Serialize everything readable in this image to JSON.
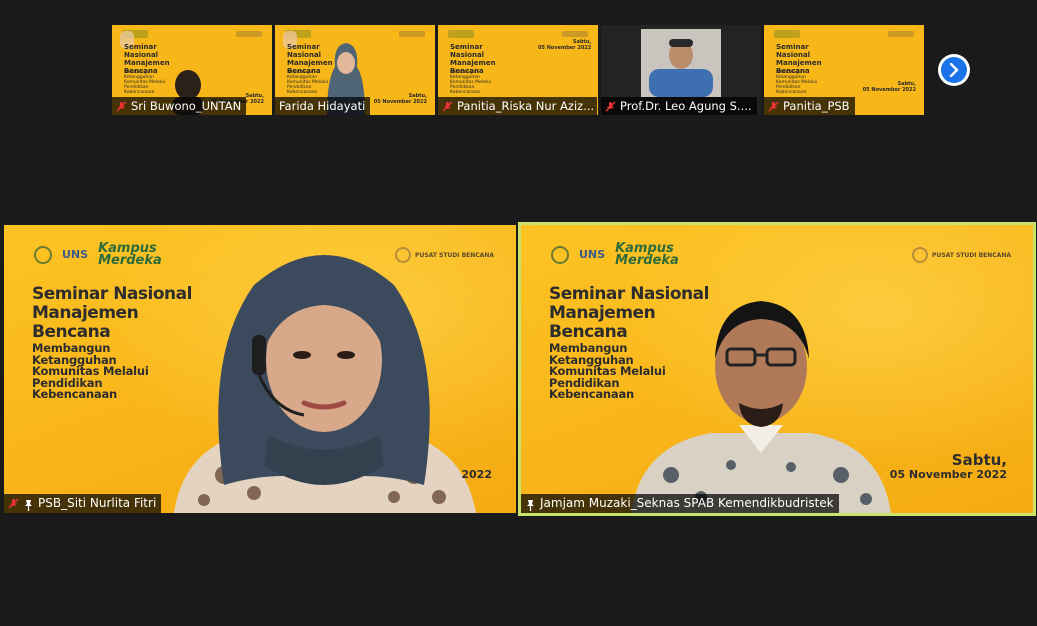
{
  "colors": {
    "accent": "#1a73e8",
    "active_speaker": "#c7e36c",
    "slide_bg": "#f9b91a"
  },
  "thumbnails": [
    {
      "name": "Sri Buwono_UNTAN",
      "muted": true
    },
    {
      "name": "Farida Hidayati",
      "muted": false
    },
    {
      "name": "Panitia_Riska Nur Aziz...",
      "muted": true
    },
    {
      "name": "Prof.Dr. Leo Agung S....",
      "muted": true
    },
    {
      "name": "Panitia_PSB",
      "muted": true
    }
  ],
  "next_icon": "chevron-right-icon",
  "slide": {
    "uns": "UNS",
    "kampus": "Kampus\nMerdeka",
    "psb": "PUSAT STUDI BENCANA",
    "title": "Seminar Nasional\nManajemen\nBencana",
    "subtitle": "Membangun\nKetangguhan\nKomunitas Melalui\nPendidikan\nKebencanaan",
    "day": "Sabtu,",
    "date": "05 November 2022",
    "left_date_partial": "2022"
  },
  "speakers": [
    {
      "name": "PSB_Siti Nurlita Fitri",
      "muted": true,
      "pinned": true
    },
    {
      "name": "Jamjam Muzaki_Seknas SPAB Kemendikbudristek",
      "muted": false,
      "pinned": true
    }
  ]
}
